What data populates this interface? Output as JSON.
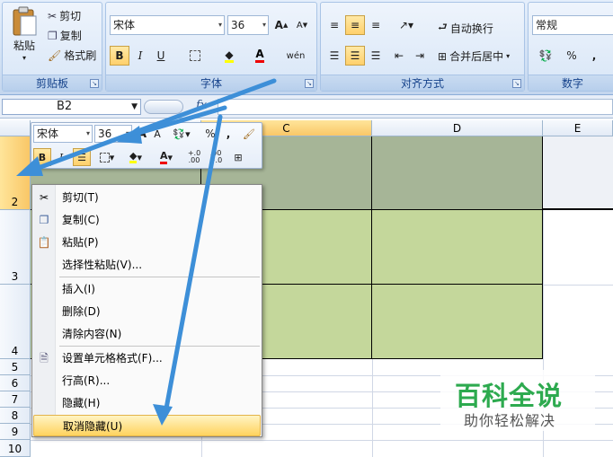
{
  "ribbon": {
    "clipboard": {
      "paste": "粘贴",
      "cut": "剪切",
      "copy": "复制",
      "format_painter": "格式刷",
      "label": "剪贴板"
    },
    "font": {
      "family": "宋体",
      "size": "36",
      "bold": "B",
      "italic": "I",
      "underline": "U",
      "label": "字体",
      "phonetic": "wén"
    },
    "alignment": {
      "wrap": "自动换行",
      "merge": "合并后居中",
      "label": "对齐方式"
    },
    "number": {
      "format": "常规",
      "percent": "%",
      "comma": ",",
      "label": "数字"
    }
  },
  "formula_bar": {
    "name_box": "B2",
    "fx": "fx"
  },
  "grid": {
    "columns": [
      "C",
      "D",
      "E"
    ],
    "rows": [
      "2",
      "3",
      "4",
      "5",
      "6",
      "7",
      "8",
      "9",
      "10"
    ],
    "selected_column": "C",
    "selected_row": "2",
    "fill_colors": {
      "row2": "#a6b597",
      "rows3_4": "#c4d79b"
    }
  },
  "mini_toolbar": {
    "font": "宋体",
    "size": "36",
    "bold": "B",
    "italic": "I",
    "percent": "%",
    "comma": ",",
    "inc_decimal": "+.0 .00",
    "dec_decimal": ".00 +.0"
  },
  "context_menu": {
    "items": [
      {
        "label": "剪切(T)",
        "icon": "scissors-icon"
      },
      {
        "label": "复制(C)",
        "icon": "copy-icon"
      },
      {
        "label": "粘贴(P)",
        "icon": "paste-icon"
      },
      {
        "label": "选择性粘贴(V)...",
        "icon": ""
      },
      {
        "label": "插入(I)",
        "icon": ""
      },
      {
        "label": "删除(D)",
        "icon": ""
      },
      {
        "label": "清除内容(N)",
        "icon": ""
      },
      {
        "label": "设置单元格格式(F)...",
        "icon": "format-cells-icon"
      },
      {
        "label": "行高(R)...",
        "icon": ""
      },
      {
        "label": "隐藏(H)",
        "icon": ""
      },
      {
        "label": "取消隐藏(U)",
        "icon": ""
      }
    ],
    "highlighted": "取消隐藏(U)"
  },
  "watermark": {
    "title": "百科全说",
    "subtitle": "助你轻松解决"
  },
  "colors": {
    "accent": "#3d8fd8",
    "highlight": "#ffd35e",
    "watermark": "#2daa4f"
  }
}
